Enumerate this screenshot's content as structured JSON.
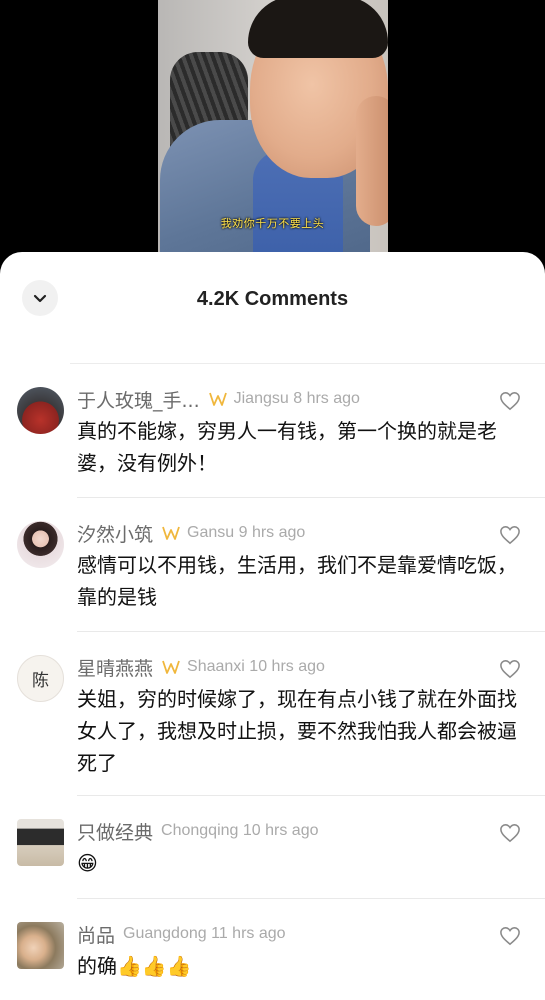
{
  "video": {
    "caption": "我劝你千万不要上头"
  },
  "sheet": {
    "title": "4.2K Comments"
  },
  "comments": [
    {
      "username": "于人玫瑰_手...",
      "location": "Jiangsu",
      "time": "8 hrs ago",
      "text": "真的不能嫁，穷男人一有钱，第一个换的就是老婆，没有例外！",
      "has_badge": true
    },
    {
      "username": "汐然小筑",
      "location": "Gansu",
      "time": "9 hrs ago",
      "text": "感情可以不用钱，生活用，我们不是靠爱情吃饭，靠的是钱",
      "has_badge": true
    },
    {
      "username": "星晴燕燕",
      "location": "Shaanxi",
      "time": "10 hrs ago",
      "text": "关姐，穷的时候嫁了，现在有点小钱了就在外面找女人了，我想及时止损，要不然我怕我人都会被逼死了",
      "has_badge": true,
      "avatar_text": "陈"
    },
    {
      "username": "只做经典",
      "location": "Chongqing",
      "time": "10 hrs ago",
      "text": "😁",
      "has_badge": false
    },
    {
      "username": "尚品",
      "location": "Guangdong",
      "time": "11 hrs ago",
      "text": "的确👍👍👍",
      "has_badge": false
    }
  ],
  "colors": {
    "badge": "#f0b73d",
    "caption": "#ffe24a",
    "meta_gray": "#aaaaaa"
  }
}
